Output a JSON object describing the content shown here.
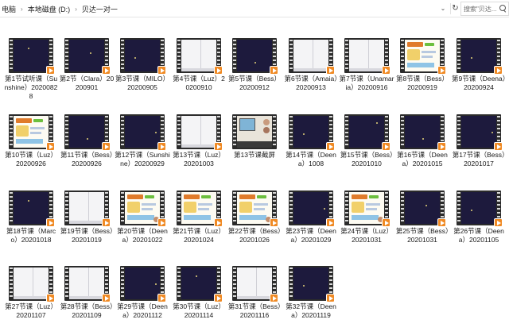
{
  "address_bar": {
    "crumbs": [
      "电脑",
      "本地磁盘 (D:)",
      "贝达一对一"
    ],
    "separator": "›",
    "dropdown_glyph": "⌄",
    "refresh_glyph": "↻",
    "search_placeholder": "搜索\"贝达...",
    "icons": [
      "chevron-down-icon",
      "refresh-icon",
      "search-icon"
    ]
  },
  "files": [
    {
      "label": "第1节试听课（Sunshine）20200828",
      "thumb": "dark"
    },
    {
      "label": "第2节（Clara）20200901",
      "thumb": "dark"
    },
    {
      "label": "第3节课（MILO）20200905",
      "thumb": "dark"
    },
    {
      "label": "第4节课（Luz）20200910",
      "thumb": "white"
    },
    {
      "label": "第5节课（Bess）20200912",
      "thumb": "dark"
    },
    {
      "label": "第6节课（Amaia）20200913",
      "thumb": "white"
    },
    {
      "label": "第7节课（Unamaria）20200916",
      "thumb": "white"
    },
    {
      "label": "第8节课（Bess）20200919",
      "thumb": "book"
    },
    {
      "label": "第9节课（Deena）20200924",
      "thumb": "dark"
    },
    {
      "label": "第10节课（Luz）20200926",
      "thumb": "book"
    },
    {
      "label": "第11节课（Bess）20200926",
      "thumb": "dark"
    },
    {
      "label": "第12节课（Sunshine）20200929",
      "thumb": "dark"
    },
    {
      "label": "第13节课（Luz）20201003",
      "thumb": "white"
    },
    {
      "label": "第13节课截屏",
      "thumb": "shot"
    },
    {
      "label": "第14节课（Deena）1008",
      "thumb": "dark"
    },
    {
      "label": "第15节课（Bess）20201010",
      "thumb": "dark"
    },
    {
      "label": "第16节课（Deena）20201015",
      "thumb": "dark"
    },
    {
      "label": "第17节课（Bess）20201017",
      "thumb": "dark"
    },
    {
      "label": "第18节课（Marco）20201018",
      "thumb": "dark"
    },
    {
      "label": "第19节课（Bess）20201019",
      "thumb": "white"
    },
    {
      "label": "第20节课（Deena）20201022",
      "thumb": "book"
    },
    {
      "label": "第21节课（Luz）20201024",
      "thumb": "book"
    },
    {
      "label": "第22节课（Bess）20201026",
      "thumb": "book"
    },
    {
      "label": "第23节课（Deena）20201029",
      "thumb": "dark"
    },
    {
      "label": "第24节课（Luz）20201031",
      "thumb": "book"
    },
    {
      "label": "第25节课（Bess）20201031",
      "thumb": "dark"
    },
    {
      "label": "第26节课（Deena）20201105",
      "thumb": "dark"
    },
    {
      "label": "第27节课（Luz）20201107",
      "thumb": "white"
    },
    {
      "label": "第28节课（Bess）20201109",
      "thumb": "white"
    },
    {
      "label": "第29节课（Deena）20201112",
      "thumb": "dark"
    },
    {
      "label": "第30节课（Luz）20201114",
      "thumb": "dark"
    },
    {
      "label": "第31节课（Bess）20201116",
      "thumb": "white"
    },
    {
      "label": "第32节课（Deena）20201119",
      "thumb": "dark"
    }
  ],
  "colors": {
    "play_badge": "#f08a24",
    "film": "#2b2b2b",
    "dark_frame": "#1d1a3d"
  }
}
